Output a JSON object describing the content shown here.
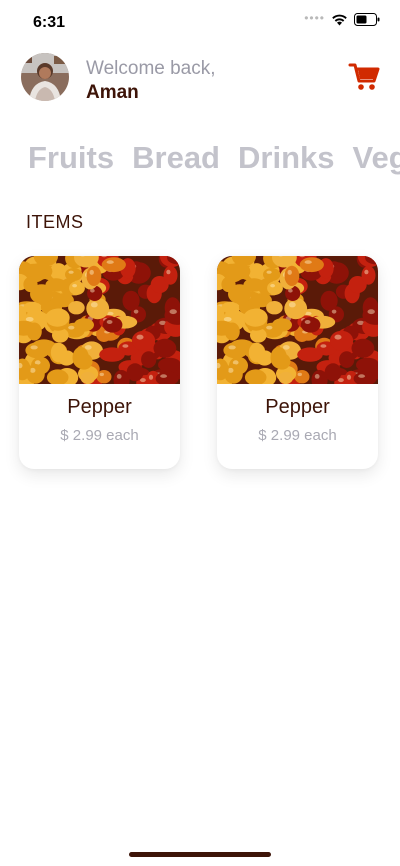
{
  "status_bar": {
    "time": "6:31",
    "signal": "••••"
  },
  "header": {
    "welcome": "Welcome back,",
    "username": "Aman"
  },
  "categories": [
    "Fruits",
    "Bread",
    "Drinks",
    "Vegetables"
  ],
  "section_title": "ITEMS",
  "items": [
    {
      "name": "Pepper",
      "price": "$ 2.99 each"
    },
    {
      "name": "Pepper",
      "price": "$ 2.99 each"
    }
  ],
  "colors": {
    "accent": "#d12a00",
    "text_dark": "#3d1408",
    "muted": "#a9a9b3",
    "category": "#c3c3cb"
  }
}
